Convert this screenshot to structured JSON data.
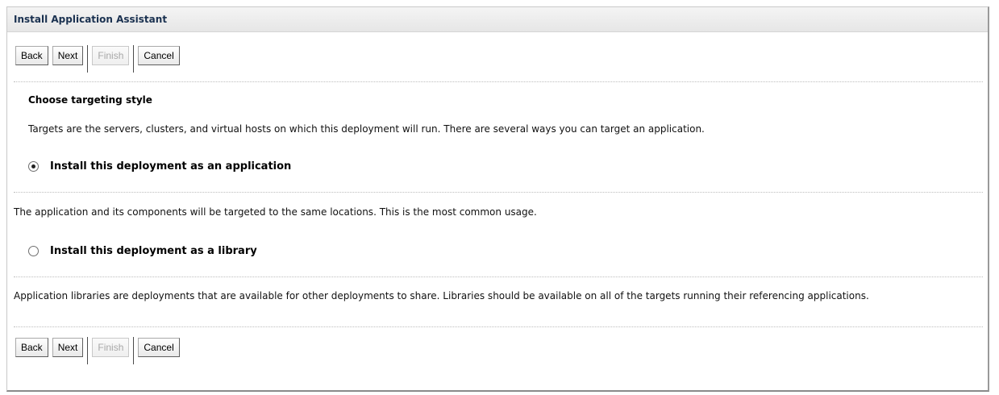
{
  "window": {
    "title": "Install Application Assistant"
  },
  "buttons": {
    "back": "Back",
    "next": "Next",
    "finish": "Finish",
    "cancel": "Cancel"
  },
  "section": {
    "heading": "Choose targeting style",
    "intro": "Targets are the servers, clusters, and virtual hosts on which this deployment will run. There are several ways you can target an application."
  },
  "options": [
    {
      "label": "Install this deployment as an application",
      "selected": true,
      "description": "The application and its components will be targeted to the same locations. This is the most common usage."
    },
    {
      "label": "Install this deployment as a library",
      "selected": false,
      "description": "Application libraries are deployments that are available for other deployments to share. Libraries should be available on all of the targets running their referencing applications."
    }
  ]
}
